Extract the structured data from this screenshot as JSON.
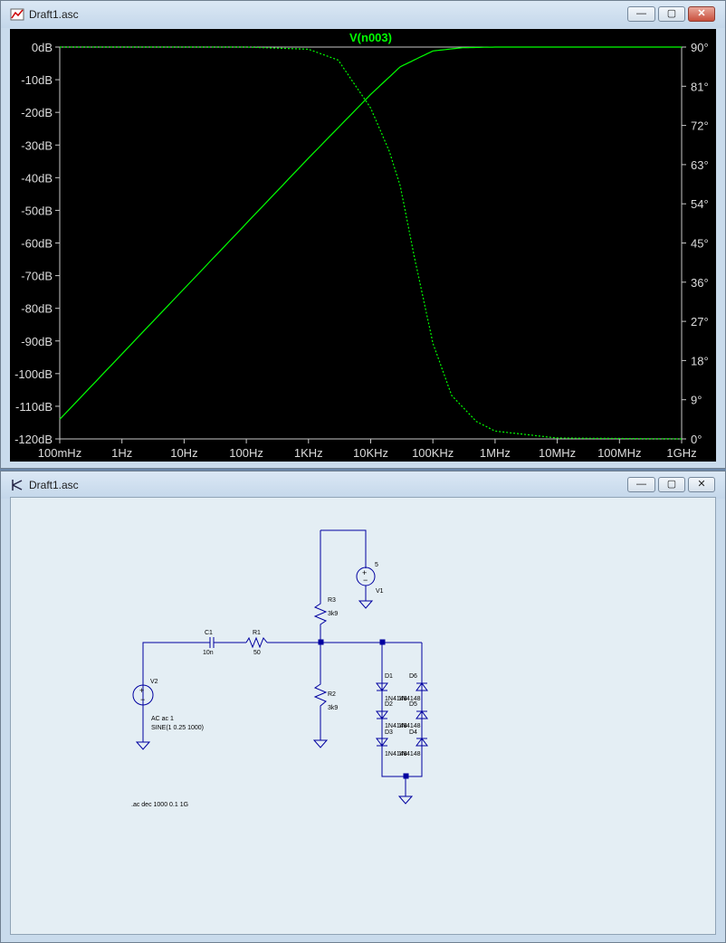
{
  "plot_window": {
    "title": "Draft1.asc",
    "icon": "waveform-icon",
    "controls": [
      "minimize-icon",
      "maximize-icon",
      "close-icon"
    ]
  },
  "schematic_window": {
    "title": "Draft1.asc",
    "icon": "schematic-icon",
    "controls": [
      "minimize-icon",
      "maximize-icon",
      "close-icon"
    ]
  },
  "colors": {
    "plot_bg": "#000000",
    "trace": "#00ff00",
    "axis_text": "#dcdcdc",
    "wire": "#0000a0",
    "schematic_bg": "#e4eef4"
  },
  "chart_data": {
    "type": "line",
    "title": "V(n003)",
    "x_scale": "log",
    "xlim": [
      0.1,
      1000000000
    ],
    "x_ticks": [
      "100mHz",
      "1Hz",
      "10Hz",
      "100Hz",
      "1KHz",
      "10KHz",
      "100KHz",
      "1MHz",
      "10MHz",
      "100MHz",
      "1GHz"
    ],
    "y_left_ticks": [
      "0dB",
      "-10dB",
      "-20dB",
      "-30dB",
      "-40dB",
      "-50dB",
      "-60dB",
      "-70dB",
      "-80dB",
      "-90dB",
      "-100dB",
      "-110dB",
      "-120dB"
    ],
    "y_right_ticks": [
      "90°",
      "81°",
      "72°",
      "63°",
      "54°",
      "45°",
      "36°",
      "27°",
      "18°",
      "9°",
      "0°"
    ],
    "ylim_left": [
      -120,
      0
    ],
    "ylim_right": [
      0,
      90
    ],
    "grid": false,
    "series": [
      {
        "style": "solid",
        "axis": "left",
        "points": [
          [
            0.1,
            -114
          ],
          [
            1,
            -94
          ],
          [
            10,
            -74
          ],
          [
            100,
            -54
          ],
          [
            1000,
            -34
          ],
          [
            10000,
            -14.5
          ],
          [
            30000,
            -6
          ],
          [
            100000,
            -1.2
          ],
          [
            300000,
            -0.2
          ],
          [
            1000000,
            0
          ],
          [
            1000000000,
            0
          ]
        ]
      },
      {
        "style": "dotted",
        "axis": "right",
        "points": [
          [
            0.1,
            90
          ],
          [
            100,
            90
          ],
          [
            1000,
            89.5
          ],
          [
            3000,
            87
          ],
          [
            10000,
            76
          ],
          [
            20000,
            66
          ],
          [
            30000,
            58
          ],
          [
            50000,
            42
          ],
          [
            100000,
            22
          ],
          [
            200000,
            10
          ],
          [
            500000,
            4
          ],
          [
            1000000,
            1.8
          ],
          [
            10000000,
            0.2
          ],
          [
            1000000000,
            0
          ]
        ]
      }
    ]
  },
  "schematic": {
    "components": {
      "c1": {
        "name": "C1",
        "value": "10n"
      },
      "r1": {
        "name": "R1",
        "value": "50"
      },
      "r3": {
        "name": "R3",
        "value": "3k9"
      },
      "r2": {
        "name": "R2",
        "value": "3k9"
      },
      "v1": {
        "name": "V1",
        "value": "5"
      },
      "v2": {
        "name": "V2",
        "value1": "AC ac 1",
        "value2": "SINE(1 0.25 1000)"
      },
      "d1": {
        "name": "D1"
      },
      "d2": {
        "name": "D2"
      },
      "d3": {
        "name": "D3"
      },
      "d4": {
        "name": "D4"
      },
      "d5": {
        "name": "D5"
      },
      "d6": {
        "name": "D6"
      },
      "diode_model_row1": "1N4148",
      "diode_model_row2": "1N4148",
      "diode_model_row3": "1N4148",
      "diode_model_row1b": "1N4148",
      "diode_model_row2b": "1N4148",
      "diode_model_row3b": "1N4148"
    },
    "directive": ".ac dec 1000 0.1 1G"
  }
}
